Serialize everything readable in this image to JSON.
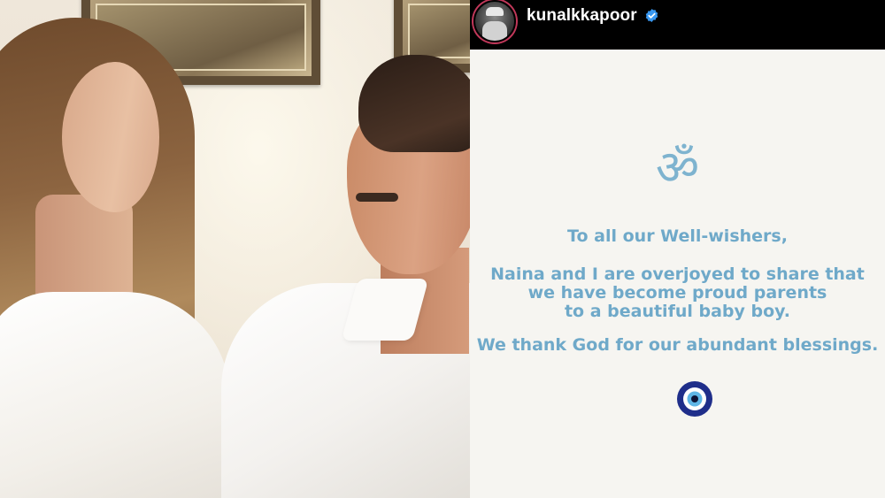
{
  "header": {
    "username": "kunalkkapoor",
    "verified_icon": "verified-badge-icon",
    "avatar_icon": "profile-avatar"
  },
  "post": {
    "symbol": "ॐ",
    "greeting": "To all our Well-wishers,",
    "lines": [
      "Naina and I are overjoyed to share that",
      "we have become proud parents",
      "to a beautiful baby boy."
    ],
    "thanks": "We thank God for our abundant blessings.",
    "evil_eye_icon": "evil-eye-icon"
  },
  "colors": {
    "header_bg": "#000000",
    "post_bg": "#f6f5f1",
    "text_blue": "#6fa9c9",
    "verified_blue": "#3897f0",
    "eye_navy": "#1f2e8a"
  }
}
